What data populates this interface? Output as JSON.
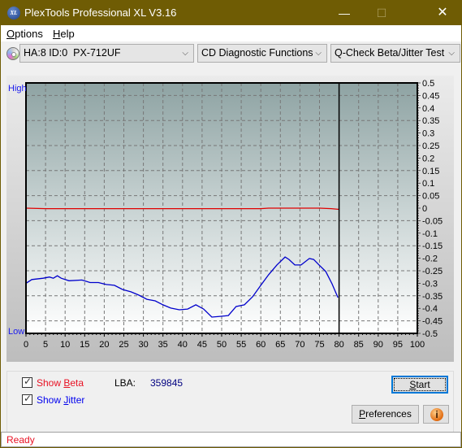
{
  "window": {
    "title": "PlexTools Professional XL V3.16",
    "icon": "xl-app-icon",
    "controls": {
      "minimize": "—",
      "maximize": "☐",
      "close": "✕"
    }
  },
  "menu": {
    "items": [
      {
        "label": "Options",
        "accel": "O",
        "rest": "ptions"
      },
      {
        "label": "Help",
        "accel": "H",
        "rest": "elp"
      }
    ]
  },
  "toolbar": {
    "device_icon": "cd-disc-icon",
    "device": "HA:8 ID:0  PX-712UF",
    "function_group": "CD Diagnostic Functions",
    "test": "Q-Check Beta/Jitter Test",
    "dropdown_arrow": "⌵"
  },
  "chart_data": {
    "type": "line",
    "title": "",
    "xlabel": "",
    "ylabel_left_high": "High",
    "ylabel_left_low": "Low",
    "xlim": [
      0,
      100
    ],
    "ylim": [
      -0.5,
      0.5
    ],
    "x_ticks": [
      0,
      5,
      10,
      15,
      20,
      25,
      30,
      35,
      40,
      45,
      50,
      55,
      60,
      65,
      70,
      75,
      80,
      85,
      90,
      95,
      100
    ],
    "y_ticks": [
      "0.5",
      "0.45",
      "0.4",
      "0.35",
      "0.3",
      "0.25",
      "0.2",
      "0.15",
      "0.1",
      "0.05",
      "0",
      "-0.05",
      "-0.1",
      "-0.15",
      "-0.2",
      "-0.25",
      "-0.3",
      "-0.35",
      "-0.4",
      "-0.45",
      "-0.5"
    ],
    "grid": true,
    "progress_marker_x": 80,
    "series": [
      {
        "name": "Beta",
        "color": "#e00000",
        "x": [
          0,
          5,
          10,
          15,
          20,
          25,
          30,
          35,
          40,
          45,
          50,
          55,
          60,
          62,
          65,
          70,
          75,
          78,
          80
        ],
        "y": [
          0.0,
          -0.002,
          -0.002,
          -0.002,
          -0.002,
          -0.002,
          -0.002,
          -0.002,
          -0.002,
          -0.002,
          -0.002,
          -0.002,
          -0.002,
          0.0,
          0.0,
          0.0,
          0.0,
          -0.002,
          -0.005
        ]
      },
      {
        "name": "Jitter",
        "color": "#0000cc",
        "x": [
          0,
          1.5,
          4.4,
          6,
          7,
          8,
          9,
          11,
          14.3,
          16.4,
          18.5,
          20.5,
          22.6,
          24.7,
          26.8,
          28.8,
          30.9,
          33,
          35,
          37,
          39.2,
          41.3,
          43.4,
          45.4,
          47.5,
          49.6,
          51.7,
          53.7,
          55.8,
          57.9,
          60,
          62,
          64.1,
          66.2,
          67.2,
          68.7,
          70.3,
          72.4,
          73.5,
          74.9,
          76.6,
          78.2,
          79.7
        ],
        "y": [
          -0.3,
          -0.285,
          -0.28,
          -0.275,
          -0.28,
          -0.27,
          -0.28,
          -0.29,
          -0.287,
          -0.297,
          -0.297,
          -0.305,
          -0.308,
          -0.325,
          -0.334,
          -0.347,
          -0.364,
          -0.37,
          -0.386,
          -0.399,
          -0.406,
          -0.403,
          -0.386,
          -0.403,
          -0.435,
          -0.432,
          -0.429,
          -0.393,
          -0.386,
          -0.354,
          -0.308,
          -0.266,
          -0.227,
          -0.195,
          -0.205,
          -0.227,
          -0.227,
          -0.201,
          -0.205,
          -0.227,
          -0.253,
          -0.302,
          -0.357
        ]
      }
    ]
  },
  "controls": {
    "show_beta": {
      "label_pre": "Show ",
      "accel": "B",
      "label_post": "eta",
      "checked": true,
      "color": "#e81123"
    },
    "show_jitter": {
      "label_pre": "Show ",
      "accel": "J",
      "label_post": "itter",
      "checked": true,
      "color": "#0000ee"
    },
    "lba_label": "LBA:",
    "lba_value": "359845",
    "start_button": {
      "accel": "S",
      "rest": "tart"
    },
    "preferences_button": {
      "accel": "P",
      "rest": "references"
    },
    "info_button": "i"
  },
  "status": {
    "text": "Ready"
  }
}
